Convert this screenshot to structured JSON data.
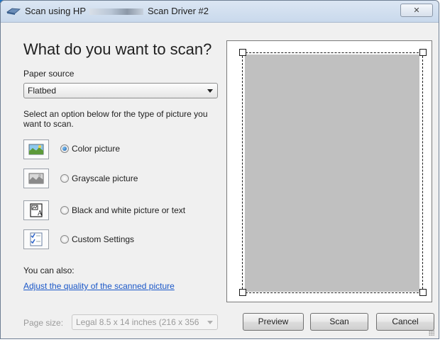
{
  "window": {
    "title_prefix": "Scan using HP",
    "title_suffix": "Scan Driver #2",
    "close_glyph": "✕"
  },
  "main": {
    "heading": "What do you want to scan?",
    "paper_source_label": "Paper source",
    "paper_source_value": "Flatbed",
    "instruction": "Select an option below for the type of picture you want to scan.",
    "options": [
      {
        "label": "Color picture",
        "selected": true,
        "icon": "color-picture-icon"
      },
      {
        "label": "Grayscale picture",
        "selected": false,
        "icon": "grayscale-picture-icon"
      },
      {
        "label": "Black and white picture or text",
        "selected": false,
        "icon": "bw-text-icon"
      },
      {
        "label": "Custom Settings",
        "selected": false,
        "icon": "custom-settings-icon"
      }
    ],
    "also_label": "You can also:",
    "adjust_link": "Adjust the quality of the scanned picture",
    "page_size_label": "Page size:",
    "page_size_value": "Legal 8.5 x 14 inches (216 x 356"
  },
  "buttons": {
    "preview": "Preview",
    "scan": "Scan",
    "cancel": "Cancel"
  },
  "colors": {
    "link": "#1a57c8",
    "scan_area": "#c0c0c0",
    "accent": "#1a5aa8"
  }
}
